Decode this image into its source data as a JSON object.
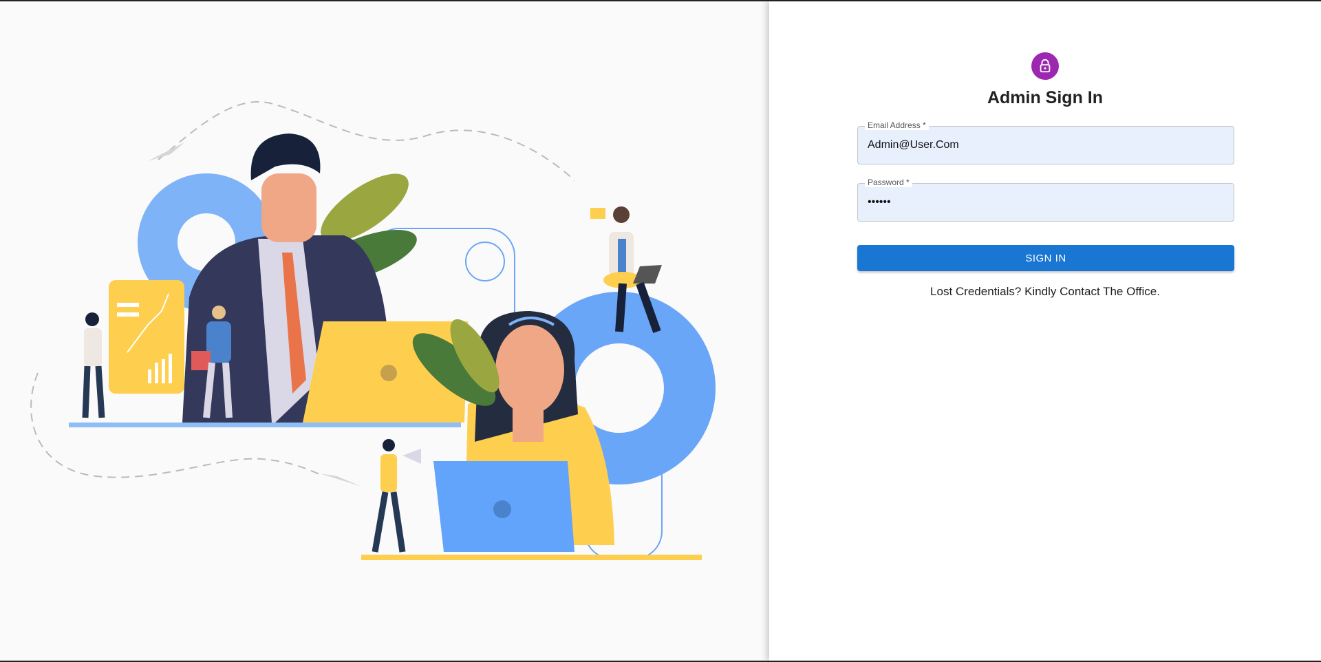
{
  "signin": {
    "title": "Admin Sign In",
    "lock_icon": "lock-icon",
    "email": {
      "label": "Email Address *",
      "value": "Admin@User.Com"
    },
    "password": {
      "label": "Password *",
      "value": "••••••"
    },
    "button_label": "SIGN IN",
    "help_text": "Lost Credentials? Kindly Contact The Office."
  },
  "colors": {
    "avatar": "#9c27b0",
    "button": "#1976d2",
    "field_bg": "#e8f0fe"
  }
}
